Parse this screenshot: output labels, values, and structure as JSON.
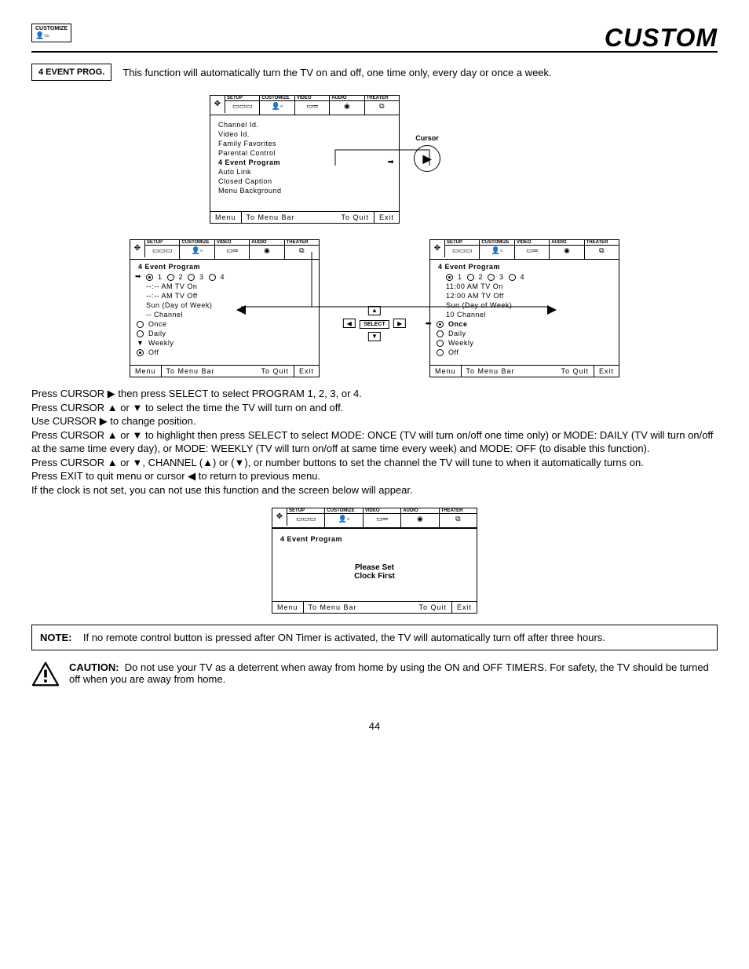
{
  "header": {
    "corner_label": "CUSTOMIZE",
    "title": "CUSTOM"
  },
  "section": {
    "label": "4 EVENT PROG.",
    "description": "This function will automatically turn the TV on and off, one time only, every day or once a week."
  },
  "tabs": {
    "setup": "SETUP",
    "customize": "CUSTOMIZE",
    "video": "VIDEO",
    "audio": "AUDIO",
    "theater": "THEATER"
  },
  "customize_menu": {
    "items": [
      "Channel Id.",
      "Video Id.",
      "Family Favorites",
      "Parental Control",
      "4 Event Program",
      "Auto Link",
      "Closed Caption",
      "Menu Background"
    ],
    "selected_index": 4
  },
  "cursor_label": "Cursor",
  "menu_footer": {
    "menu": "Menu",
    "to_menu_bar": "To Menu Bar",
    "to_quit": "To Quit",
    "exit": "Exit"
  },
  "prog_left": {
    "title": "4 Event Program",
    "nums": "1       2       3       4",
    "tv_on": "--:-- AM TV On",
    "tv_off": "--:-- AM TV Off",
    "dow": "Sun (Day of Week)",
    "channel": "-- Channel",
    "modes": [
      "Once",
      "Daily",
      "Weekly",
      "Off"
    ],
    "filled_prog": 0,
    "filled_mode": 3
  },
  "prog_right": {
    "title": "4 Event Program",
    "nums": "1       2       3       4",
    "tv_on": "11:00 AM TV On",
    "tv_off": "12:00 AM TV Off",
    "dow": "Sun  (Day of Week)",
    "channel": "10 Channel",
    "modes": [
      "Once",
      "Daily",
      "Weekly",
      "Off"
    ],
    "filled_prog": 0,
    "filled_mode": 0
  },
  "select_label": "SELECT",
  "instructions": {
    "l1a": "Press CURSOR ",
    "l1b": " then press SELECT to select PROGRAM 1, 2, 3, or 4.",
    "l2a": "Press CURSOR ",
    "l2b": " or ",
    "l2c": " to select the time the TV will turn on and off.",
    "l3a": "Use CURSOR ",
    "l3b": " to change position.",
    "l4a": "Press CURSOR ",
    "l4b": " or ",
    "l4c": " to highlight then press SELECT to select MODE: ONCE (TV will turn on/off one time only) or MODE: DAILY (TV will turn on/off at the same time every day), or MODE: WEEKLY (TV will turn on/off at same time every week) and MODE: OFF (to disable this function).",
    "l5a": "Press CURSOR ",
    "l5b": " or ",
    "l5c": ", CHANNEL (",
    "l5d": ") or (",
    "l5e": "), or number buttons to set the channel the TV will tune to when it automatically turns on.",
    "l6a": "Press EXIT to quit menu or cursor ",
    "l6b": " to return to previous menu.",
    "l7": "If the clock is not set, you can not use this function and the screen below will appear."
  },
  "clock_screen": {
    "title": "4 Event Program",
    "msg1": "Please Set",
    "msg2": "Clock First"
  },
  "note": {
    "label": "NOTE:",
    "text": "If no remote control button is pressed after ON Timer is activated, the TV will automatically turn off after three hours."
  },
  "caution": {
    "label": "CAUTION:",
    "text": "Do not use your TV as a deterrent when away from home by using the ON and OFF TIMERS.  For safety, the TV should be turned off when you are away from home."
  },
  "page_number": "44"
}
